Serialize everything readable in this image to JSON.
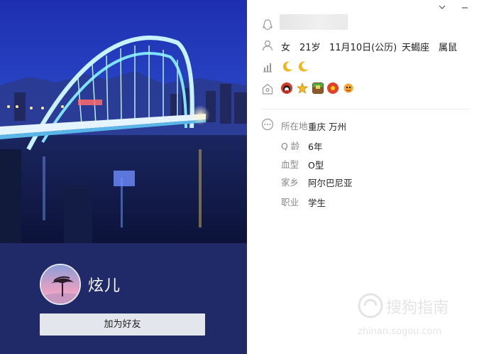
{
  "profile": {
    "nickname": "炫儿",
    "add_friend_label": "加为好友"
  },
  "basic": {
    "gender": "女",
    "age": "21岁",
    "birthday": "11月10日(公历)",
    "zodiac": "天蝎座",
    "chinese_zodiac": "属鼠"
  },
  "details": {
    "location": {
      "label": "所在地",
      "value": "重庆 万州"
    },
    "q_age": {
      "label": "Q 龄",
      "value": "6年"
    },
    "blood": {
      "label": "血型",
      "value": "O型"
    },
    "hometown": {
      "label": "家乡",
      "value": "阿尔巴尼亚"
    },
    "job": {
      "label": "职业",
      "value": "学生"
    }
  },
  "watermark": {
    "brand": "搜狗指南",
    "url": "zhinan.sogou.com"
  },
  "colors": {
    "left_panel_bg": "#202a68",
    "moon_yellow": "#f3b61a"
  },
  "icons": [
    "qq-icon",
    "user-icon",
    "level-icon",
    "home-icon",
    "more-icon",
    "chevron-down-icon",
    "minimize-icon"
  ]
}
